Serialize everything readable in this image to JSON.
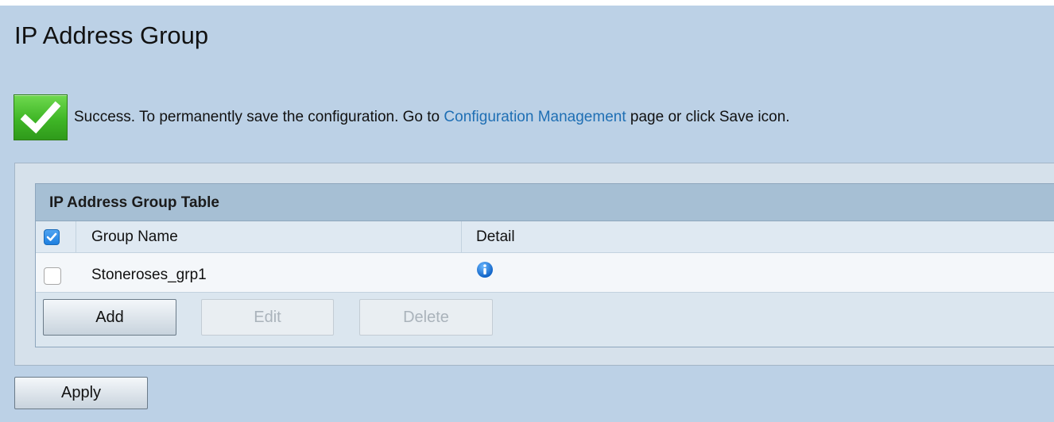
{
  "page": {
    "title": "IP Address Group"
  },
  "success": {
    "icon": "checkmark-icon",
    "message_prefix": "Success. To permanently save the configuration. Go to ",
    "link_text": "Configuration Management",
    "message_suffix": " page or click Save icon.",
    "icon_color": "#3fb626",
    "link_color": "#1f6fb4"
  },
  "table": {
    "caption": "IP Address Group Table",
    "columns": [
      {
        "label": "Group Name"
      },
      {
        "label": "Detail"
      }
    ],
    "select_all_checked": true,
    "rows": [
      {
        "group_name": "Stoneroses_grp1",
        "detail_icon": "info-icon",
        "checked": false
      }
    ],
    "buttons": {
      "add": "Add",
      "edit": "Edit",
      "delete": "Delete"
    }
  },
  "apply_label": "Apply"
}
